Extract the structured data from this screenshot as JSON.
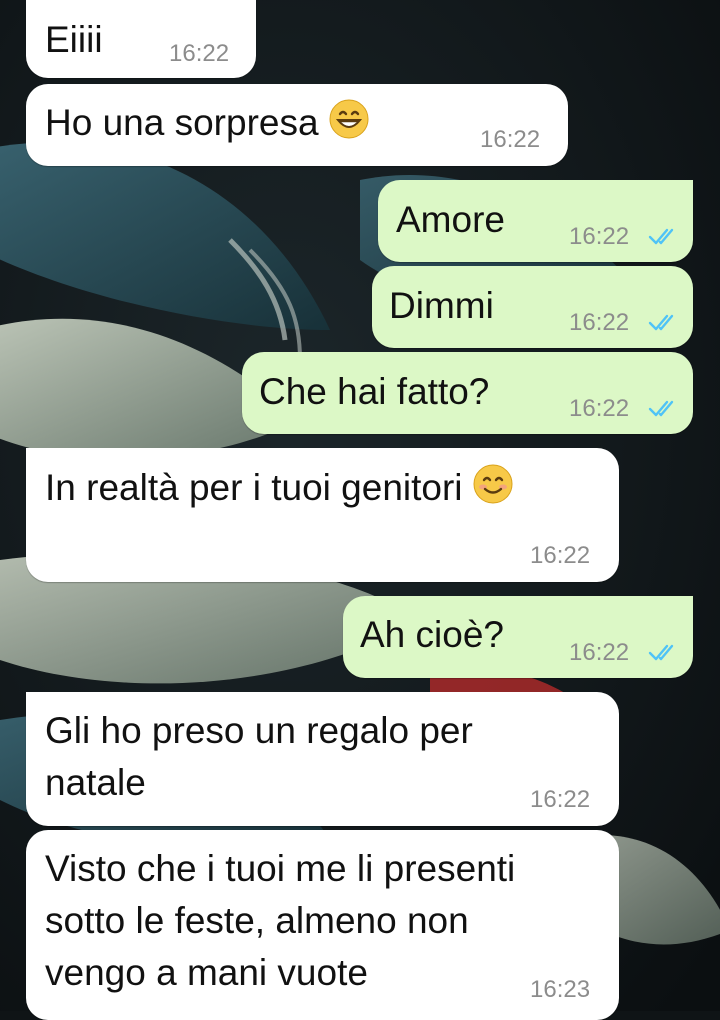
{
  "chat": {
    "messages": [
      {
        "dir": "in",
        "lines": [
          "Eiiii"
        ],
        "time": "16:22"
      },
      {
        "dir": "in",
        "lines": [
          "Ho una sorpresa"
        ],
        "emoji": "grinning-face-emoji",
        "time": "16:22"
      },
      {
        "dir": "out",
        "lines": [
          "Amore"
        ],
        "time": "16:22",
        "status": "read"
      },
      {
        "dir": "out",
        "lines": [
          "Dimmi"
        ],
        "time": "16:22",
        "status": "read"
      },
      {
        "dir": "out",
        "lines": [
          "Che hai fatto?"
        ],
        "time": "16:22",
        "status": "read"
      },
      {
        "dir": "in",
        "lines": [
          "In realtà per i tuoi genitori"
        ],
        "emoji": "smiling-face-emoji",
        "time": "16:22"
      },
      {
        "dir": "out",
        "lines": [
          "Ah cioè?"
        ],
        "time": "16:22",
        "status": "read"
      },
      {
        "dir": "in",
        "lines": [
          "Gli ho preso un regalo per",
          "natale"
        ],
        "time": "16:22"
      },
      {
        "dir": "in",
        "lines": [
          "Visto che i tuoi me li presenti",
          "sotto le feste, almeno non",
          "vengo a mani vuote"
        ],
        "time": "16:23"
      }
    ]
  },
  "colors": {
    "incoming_bubble": "#ffffff",
    "outgoing_bubble": "#dcf8c6",
    "read_tick": "#4fc3f7",
    "timestamp": "#8c8c8c"
  }
}
